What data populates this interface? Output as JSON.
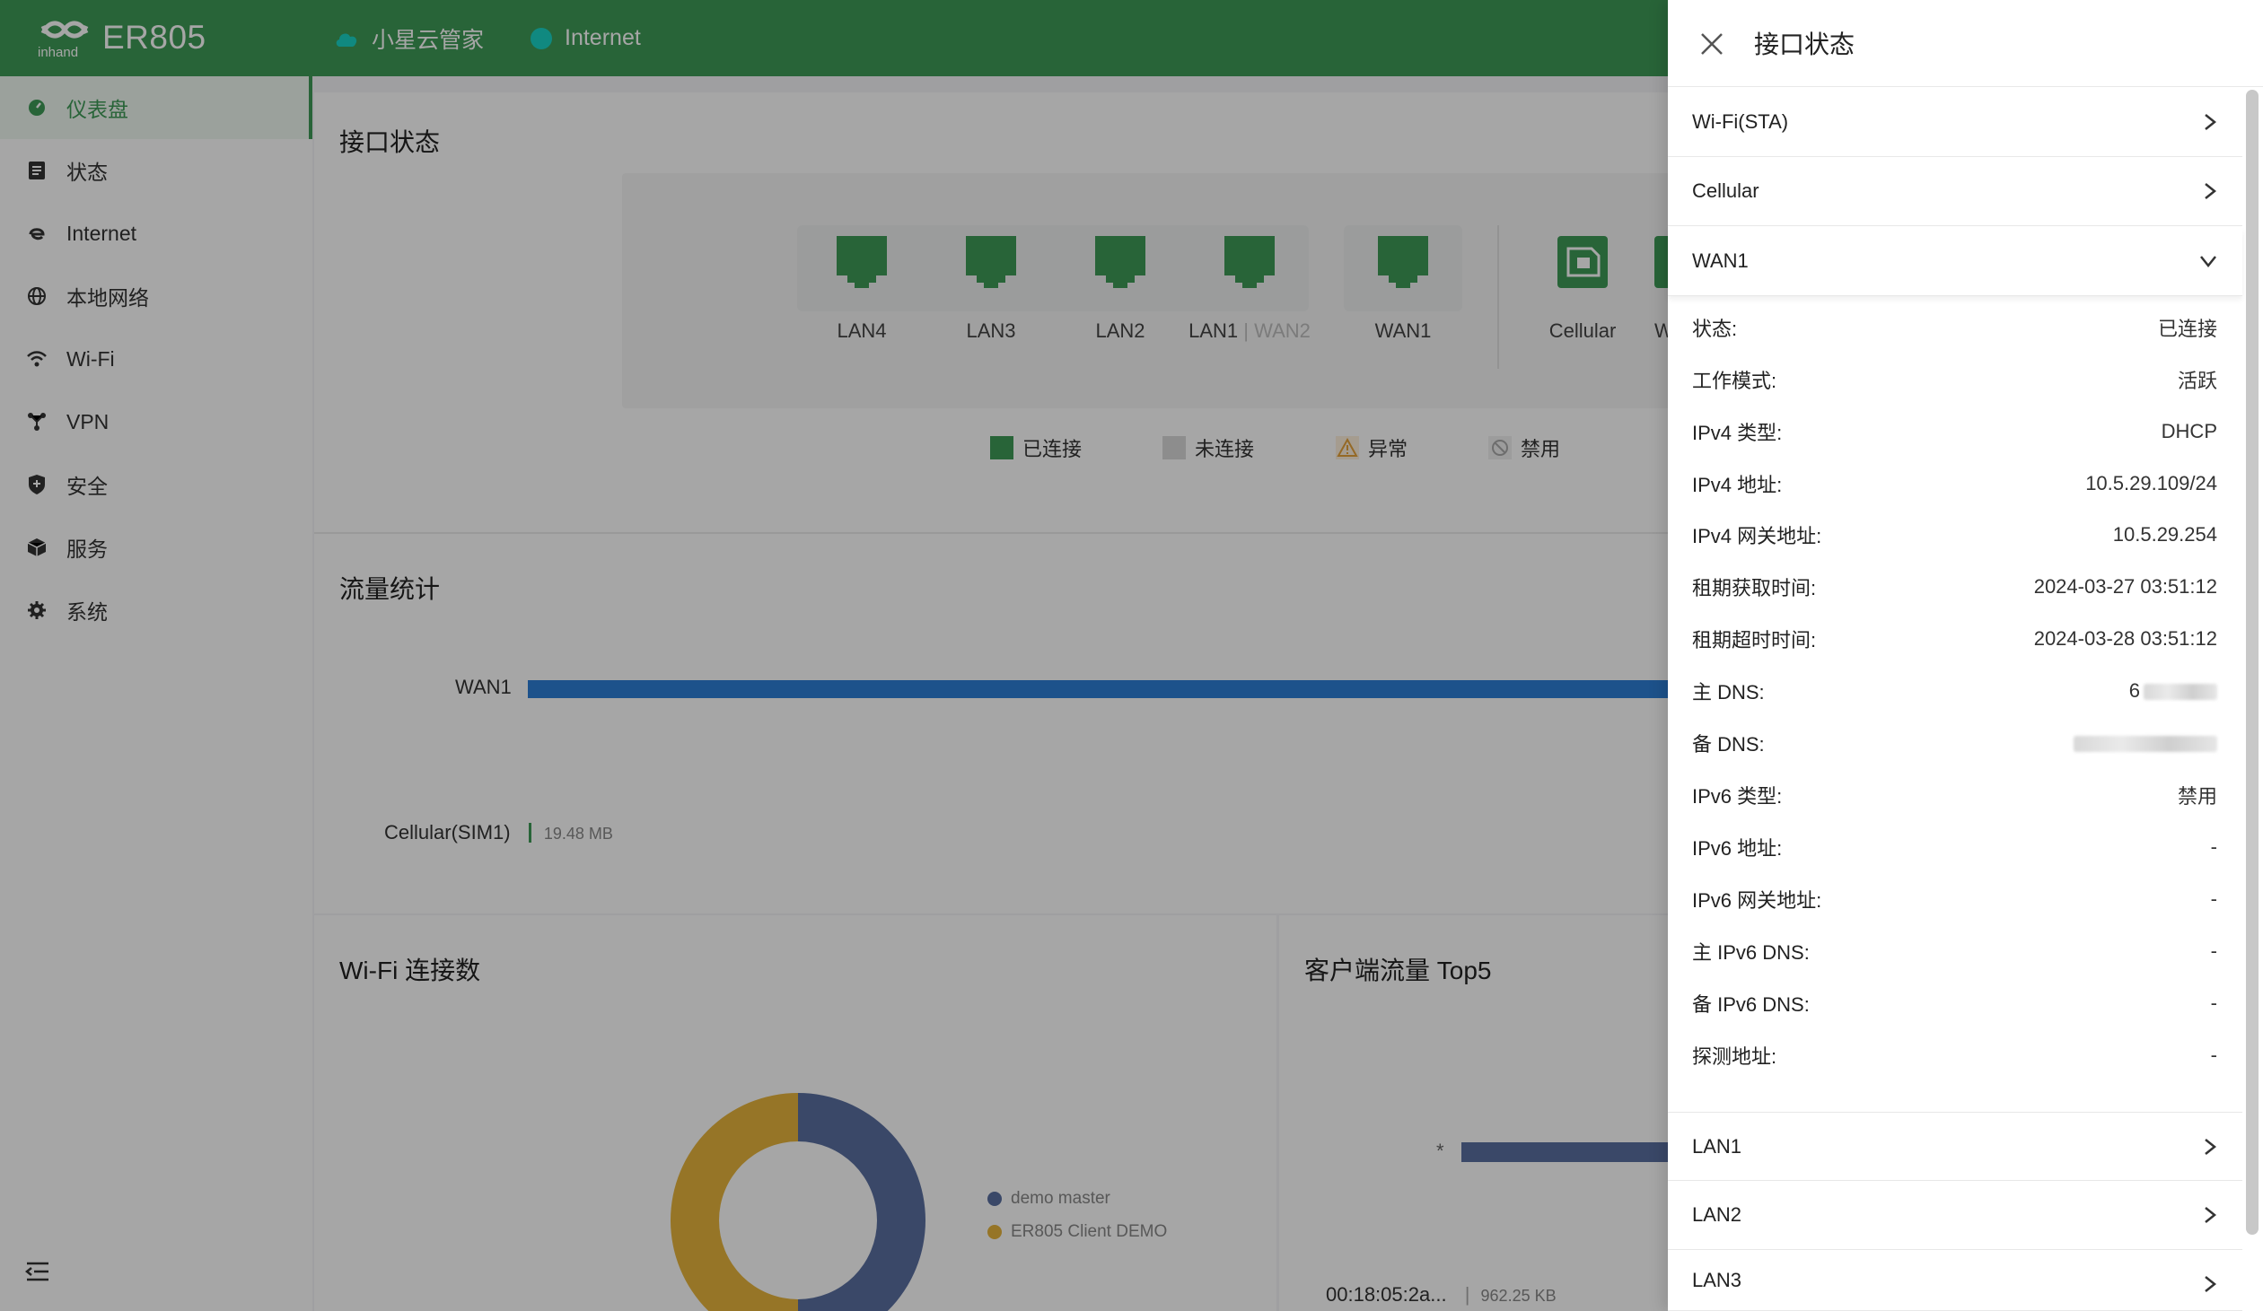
{
  "header": {
    "brand": "ER805",
    "logo_text": "inhand",
    "nav": [
      {
        "label": "小星云管家",
        "icon": "cloud-icon"
      },
      {
        "label": "Internet",
        "icon": "status-dot-icon"
      }
    ]
  },
  "sidebar": {
    "items": [
      {
        "label": "仪表盘",
        "icon": "dashboard-icon",
        "active": true
      },
      {
        "label": "状态",
        "icon": "status-list-icon"
      },
      {
        "label": "Internet",
        "icon": "internet-explorer-icon"
      },
      {
        "label": "本地网络",
        "icon": "globe-icon"
      },
      {
        "label": "Wi-Fi",
        "icon": "wifi-icon"
      },
      {
        "label": "VPN",
        "icon": "vpn-icon"
      },
      {
        "label": "安全",
        "icon": "shield-icon"
      },
      {
        "label": "服务",
        "icon": "cube-icon"
      },
      {
        "label": "系统",
        "icon": "gear-icon"
      }
    ]
  },
  "interface_status": {
    "title": "接口状态",
    "ports": [
      "LAN4",
      "LAN3",
      "LAN2",
      "LAN1",
      "WAN2",
      "WAN1",
      "Cellular",
      "Wi-"
    ],
    "legend": [
      {
        "label": "已连接",
        "color": "#3e9a56"
      },
      {
        "label": "未连接",
        "color": "#cfcfcf"
      },
      {
        "label": "异常",
        "color": "#e5a23a"
      },
      {
        "label": "禁用",
        "color": "#bdbdbd"
      }
    ]
  },
  "traffic": {
    "title": "流量统计",
    "rows": [
      {
        "label": "WAN1"
      },
      {
        "label": "Cellular(SIM1)",
        "value": "19.48 MB"
      }
    ]
  },
  "wifi": {
    "title": "Wi-Fi 连接数",
    "legend": [
      {
        "label": "demo master",
        "color": "#5a6fa0"
      },
      {
        "label": "ER805 Client DEMO",
        "color": "#e6b43c"
      }
    ]
  },
  "client_top5": {
    "title": "客户端流量 Top5",
    "marker": "*",
    "client": "00:18:05:2a...",
    "value": "962.25 KB"
  },
  "drawer": {
    "title": "接口状态",
    "sections": [
      {
        "label": "Wi-Fi(STA)"
      },
      {
        "label": "Cellular"
      },
      {
        "label": "WAN1"
      }
    ],
    "wan1_details": [
      {
        "k": "状态:",
        "v": "已连接"
      },
      {
        "k": "工作模式:",
        "v": "活跃"
      },
      {
        "k": "IPv4 类型:",
        "v": "DHCP"
      },
      {
        "k": "IPv4 地址:",
        "v": "10.5.29.109/24"
      },
      {
        "k": "IPv4 网关地址:",
        "v": "10.5.29.254"
      },
      {
        "k": "租期获取时间:",
        "v": "2024-03-27 03:51:12"
      },
      {
        "k": "租期超时时间:",
        "v": "2024-03-28 03:51:12"
      },
      {
        "k": "主 DNS:",
        "v": "6"
      },
      {
        "k": "备 DNS:",
        "v": ""
      },
      {
        "k": "IPv6 类型:",
        "v": "禁用"
      },
      {
        "k": "IPv6 地址:",
        "v": "-"
      },
      {
        "k": "IPv6 网关地址:",
        "v": "-"
      },
      {
        "k": "主 IPv6 DNS:",
        "v": "-"
      },
      {
        "k": "备 IPv6 DNS:",
        "v": "-"
      },
      {
        "k": "探测地址:",
        "v": "-"
      }
    ],
    "more_sections": [
      {
        "label": "LAN1"
      },
      {
        "label": "LAN2"
      },
      {
        "label": "LAN3"
      }
    ]
  }
}
